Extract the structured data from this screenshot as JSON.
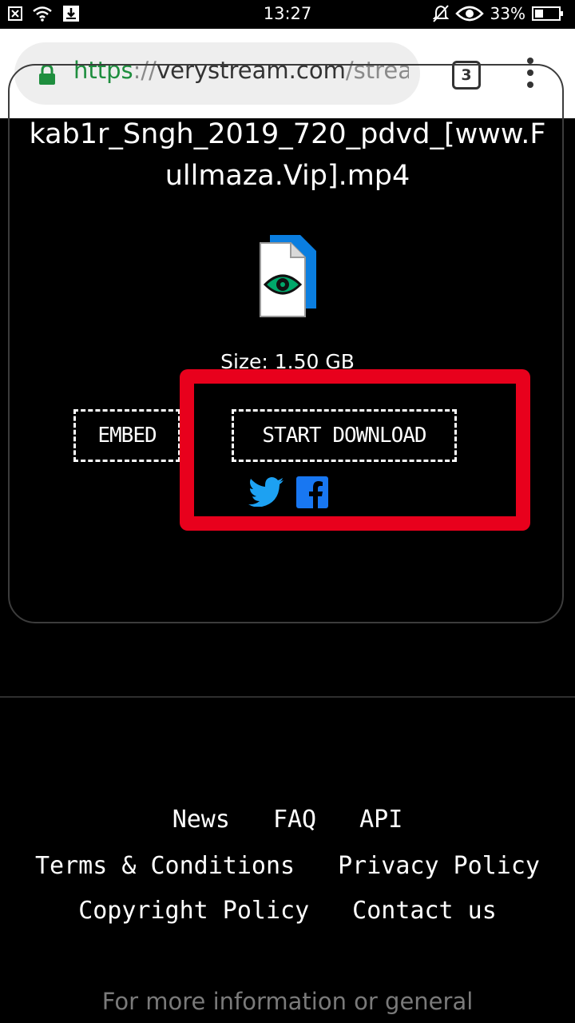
{
  "status_bar": {
    "time": "13:27",
    "battery_percent": "33%",
    "icons": [
      "notification-close-icon",
      "wifi-icon",
      "download-notification-icon",
      "mute-icon",
      "eye-comfort-icon",
      "battery-icon"
    ]
  },
  "browser": {
    "url": {
      "scheme": "https",
      "separator": "://",
      "host": "verystream.com",
      "path": "/strea"
    },
    "tab_count": "3"
  },
  "file": {
    "name": "kab1r_Sngh_2019_720_pdvd_[www.Fullmaza.Vip].mp4",
    "size": "Size: 1.50 GB"
  },
  "actions": {
    "embed": "EMBED",
    "start_download": "START DOWNLOAD"
  },
  "footer": {
    "links": {
      "news": "News",
      "faq": "FAQ",
      "api": "API",
      "terms": "Terms & Conditions",
      "privacy": "Privacy Policy",
      "copyright": "Copyright Policy",
      "contact": "Contact us"
    },
    "info": "For more information or general"
  },
  "colors": {
    "highlight": "#e8001c",
    "social_blue": "#1da1f2",
    "facebook_blue": "#1877f2",
    "url_green": "#1e8e3e"
  }
}
